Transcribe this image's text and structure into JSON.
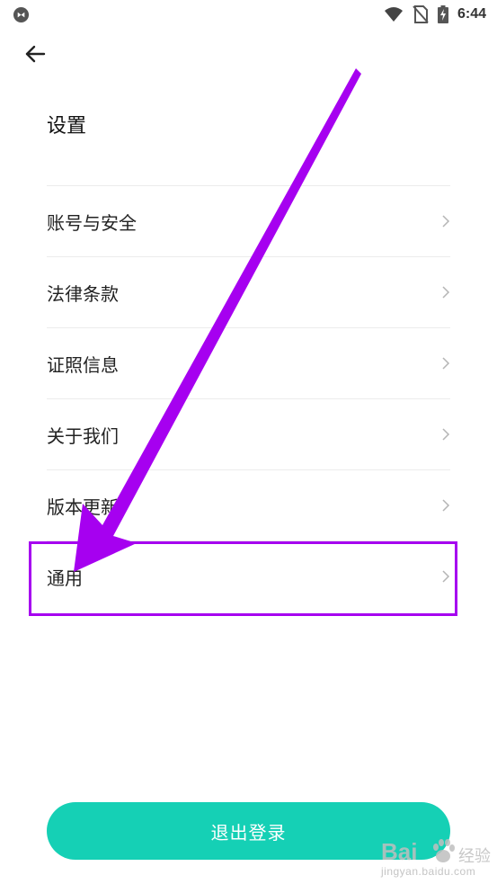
{
  "status_bar": {
    "time": "6:44",
    "left_icon": "app-notification-icon",
    "icons": [
      "wifi-icon",
      "no-sim-icon",
      "battery-charging-icon"
    ]
  },
  "header": {
    "back_icon": "back-arrow-icon",
    "title": "设置"
  },
  "settings": {
    "items": [
      {
        "label": "账号与安全",
        "icon": "chevron-right-icon"
      },
      {
        "label": "法律条款",
        "icon": "chevron-right-icon"
      },
      {
        "label": "证照信息",
        "icon": "chevron-right-icon"
      },
      {
        "label": "关于我们",
        "icon": "chevron-right-icon"
      },
      {
        "label": "版本更新",
        "icon": "chevron-right-icon"
      },
      {
        "label": "通用",
        "icon": "chevron-right-icon"
      }
    ]
  },
  "logout": {
    "label": "退出登录"
  },
  "annotation": {
    "color": "#a600f0"
  },
  "watermark": {
    "brand": "Bai",
    "suffix": "经验",
    "url": "jingyan.baidu.com"
  },
  "colors": {
    "accent": "#15d0b5",
    "highlight": "#a600f0"
  }
}
